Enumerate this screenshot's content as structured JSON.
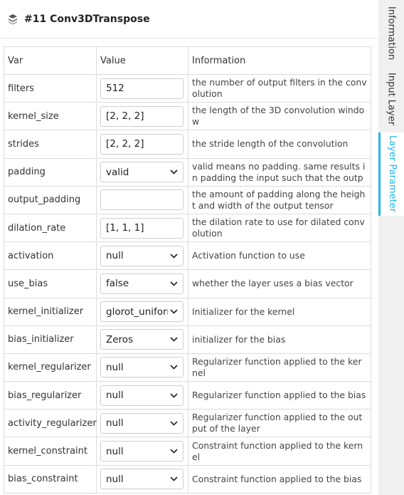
{
  "header": {
    "title": "#11 Conv3DTranspose",
    "icon": "layer-icon"
  },
  "table": {
    "columns": [
      "Var",
      "Value",
      "Information"
    ],
    "rows": [
      {
        "var": "filters",
        "value": "512",
        "kind": "input",
        "info": "the number of output filters in the convolution"
      },
      {
        "var": "kernel_size",
        "value": "[2, 2, 2]",
        "kind": "input",
        "info": "the length of the 3D convolution window"
      },
      {
        "var": "strides",
        "value": "[2, 2, 2]",
        "kind": "input",
        "info": "the stride length of the convolution"
      },
      {
        "var": "padding",
        "value": "valid",
        "kind": "select",
        "info": "valid means no padding. same results in padding the input such that the output ..."
      },
      {
        "var": "output_padding",
        "value": "",
        "kind": "input",
        "info": "the amount of padding along the height and width of the output tensor"
      },
      {
        "var": "dilation_rate",
        "value": "[1, 1, 1]",
        "kind": "input",
        "info": "the dilation rate to use for dilated convolution"
      },
      {
        "var": "activation",
        "value": "null",
        "kind": "select",
        "info": "Activation function to use"
      },
      {
        "var": "use_bias",
        "value": "false",
        "kind": "select",
        "info": "whether the layer uses a bias vector"
      },
      {
        "var": "kernel_initializer",
        "value": "glorot_uniform",
        "kind": "select",
        "info": "Initializer for the kernel"
      },
      {
        "var": "bias_initializer",
        "value": "Zeros",
        "kind": "select",
        "info": "initializer for the bias"
      },
      {
        "var": "kernel_regularizer",
        "value": "null",
        "kind": "select",
        "info": "Regularizer function applied to the kernel"
      },
      {
        "var": "bias_regularizer",
        "value": "null",
        "kind": "select",
        "info": "Regularizer function applied to the bias"
      },
      {
        "var": "activity_regularizer",
        "value": "null",
        "kind": "select",
        "info": "Regularizer function applied to the output of the layer"
      },
      {
        "var": "kernel_constraint",
        "value": "null",
        "kind": "select",
        "info": "Constraint function applied to the kernel"
      },
      {
        "var": "bias_constraint",
        "value": "null",
        "kind": "select",
        "info": "Constraint function applied to the bias"
      }
    ]
  },
  "tabs": [
    {
      "label": "Information",
      "active": false
    },
    {
      "label": "Input Layer",
      "active": false
    },
    {
      "label": "Layer Parameter",
      "active": true
    }
  ],
  "colors": {
    "accent": "#26b4e6",
    "border": "#dcdcdc",
    "sidebar_bg": "#f0f0f0"
  }
}
